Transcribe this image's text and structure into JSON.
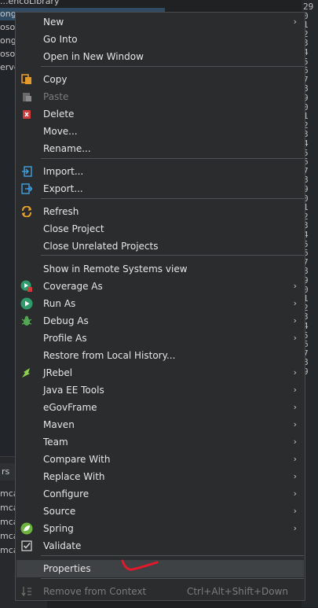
{
  "background": {
    "tree_rows": [
      "...encoLibrary",
      "ong...",
      "oso...",
      "ong...",
      "oso...",
      "erver..."
    ],
    "panel_header": "rs",
    "panel_rows": [
      "mca",
      "mca",
      "mca",
      "mca",
      "mca"
    ],
    "right_gutter": [
      "29",
      "0",
      "1",
      "2",
      "3",
      "4",
      "5",
      "6",
      "7",
      "8",
      "9",
      "0",
      "1",
      "2",
      "3",
      "4",
      "5",
      "6",
      "7",
      "8",
      "9",
      "0",
      "1",
      "2",
      "3",
      "4",
      "5",
      "6",
      "7",
      "8",
      "9",
      "0",
      "1",
      "2",
      "3",
      "4",
      "5",
      "6",
      "7",
      "8",
      "9"
    ]
  },
  "menu": {
    "items": [
      {
        "label": "New",
        "submenu": true
      },
      {
        "label": "Go Into"
      },
      {
        "label": "Open in New Window"
      },
      {
        "label": "Copy",
        "icon": "copy-icon"
      },
      {
        "label": "Paste",
        "icon": "paste-icon",
        "disabled": true
      },
      {
        "label": "Delete",
        "icon": "delete-icon"
      },
      {
        "label": "Move..."
      },
      {
        "label": "Rename..."
      },
      {
        "label": "Import...",
        "icon": "import-icon"
      },
      {
        "label": "Export...",
        "icon": "export-icon"
      },
      {
        "label": "Refresh",
        "icon": "refresh-icon"
      },
      {
        "label": "Close Project"
      },
      {
        "label": "Close Unrelated Projects"
      },
      {
        "label": "Show in Remote Systems view"
      },
      {
        "label": "Coverage As",
        "icon": "coverage-icon",
        "submenu": true
      },
      {
        "label": "Run As",
        "icon": "run-icon",
        "submenu": true
      },
      {
        "label": "Debug As",
        "icon": "debug-bug-icon",
        "submenu": true
      },
      {
        "label": "Profile As",
        "submenu": true
      },
      {
        "label": "Restore from Local History..."
      },
      {
        "label": "JRebel",
        "icon": "jrebel-icon",
        "submenu": true
      },
      {
        "label": "Java EE Tools",
        "submenu": true
      },
      {
        "label": "eGovFrame",
        "submenu": true
      },
      {
        "label": "Maven",
        "submenu": true
      },
      {
        "label": "Team",
        "submenu": true
      },
      {
        "label": "Compare With",
        "submenu": true
      },
      {
        "label": "Replace With",
        "submenu": true
      },
      {
        "label": "Configure",
        "submenu": true
      },
      {
        "label": "Source",
        "submenu": true
      },
      {
        "label": "Spring",
        "icon": "spring-icon",
        "submenu": true
      },
      {
        "label": "Validate",
        "icon": "validate-check-icon"
      },
      {
        "label": "Properties",
        "highlighted": true
      },
      {
        "label": "Remove from Context",
        "icon": "remove-context-icon",
        "disabled": true,
        "accelerator": "Ctrl+Alt+Shift+Down"
      }
    ]
  },
  "colors": {
    "menu_bg": "#2b2c2d",
    "highlight": "#3f4244",
    "annotation_red": "#e0192b"
  }
}
